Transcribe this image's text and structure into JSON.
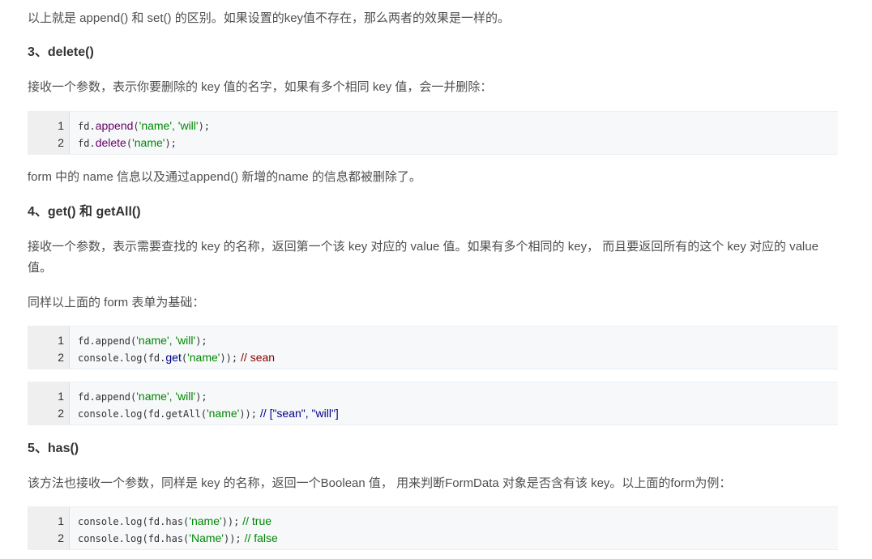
{
  "intro": "以上就是 append() 和 set() 的区别。如果设置的key值不存在，那么两者的效果是一样的。",
  "section3": {
    "heading": "3、delete()",
    "desc": "接收一个参数，表示你要删除的 key 值的名字，如果有多个相同 key 值，会一并删除：",
    "code": [
      {
        "num": "1",
        "obj": "fd.",
        "fn": "append",
        "open": "(",
        "args": "'name', 'will'",
        "close": ");"
      },
      {
        "num": "2",
        "obj": "fd.",
        "fn": "delete",
        "open": "(",
        "args": "'name'",
        "close": ");"
      }
    ],
    "after": "form 中的 name 信息以及通过append() 新增的name 的信息都被删除了。"
  },
  "section4": {
    "heading": "4、get() 和 getAll()",
    "desc": "接收一个参数，表示需要查找的 key 的名称，返回第一个该 key 对应的 value 值。如果有多个相同的 key， 而且要返回所有的这个 key 对应的 value 值。",
    "note": "同样以上面的 form 表单为基础：",
    "code1": [
      {
        "num": "1",
        "pre": "fd.append(",
        "str": "'name', 'will'",
        "post": ");",
        "comment": ""
      },
      {
        "num": "2",
        "pre": "console.log(fd.",
        "fn": "get",
        "open": "(",
        "str": "'name'",
        "post": "));",
        "comment": "// sean"
      }
    ],
    "code2": [
      {
        "num": "1",
        "pre": "fd.append(",
        "str": "'name', 'will'",
        "post": ");",
        "comment": ""
      },
      {
        "num": "2",
        "pre": "console.log(fd.getAll(",
        "str": "'name'",
        "post": "));",
        "comment": "// [\"sean\", \"will\"]"
      }
    ]
  },
  "section5": {
    "heading": "5、has()",
    "desc": "该方法也接收一个参数，同样是 key 的名称，返回一个Boolean 值， 用来判断FormData 对象是否含有该 key。以上面的form为例：",
    "code": [
      {
        "num": "1",
        "pre": "console.log(fd.has(",
        "str": "'name'",
        "post": "));",
        "comment": "// true"
      },
      {
        "num": "2",
        "pre": "console.log(fd.has(",
        "str": "'Name'",
        "post": "));",
        "comment": "// false"
      }
    ]
  }
}
